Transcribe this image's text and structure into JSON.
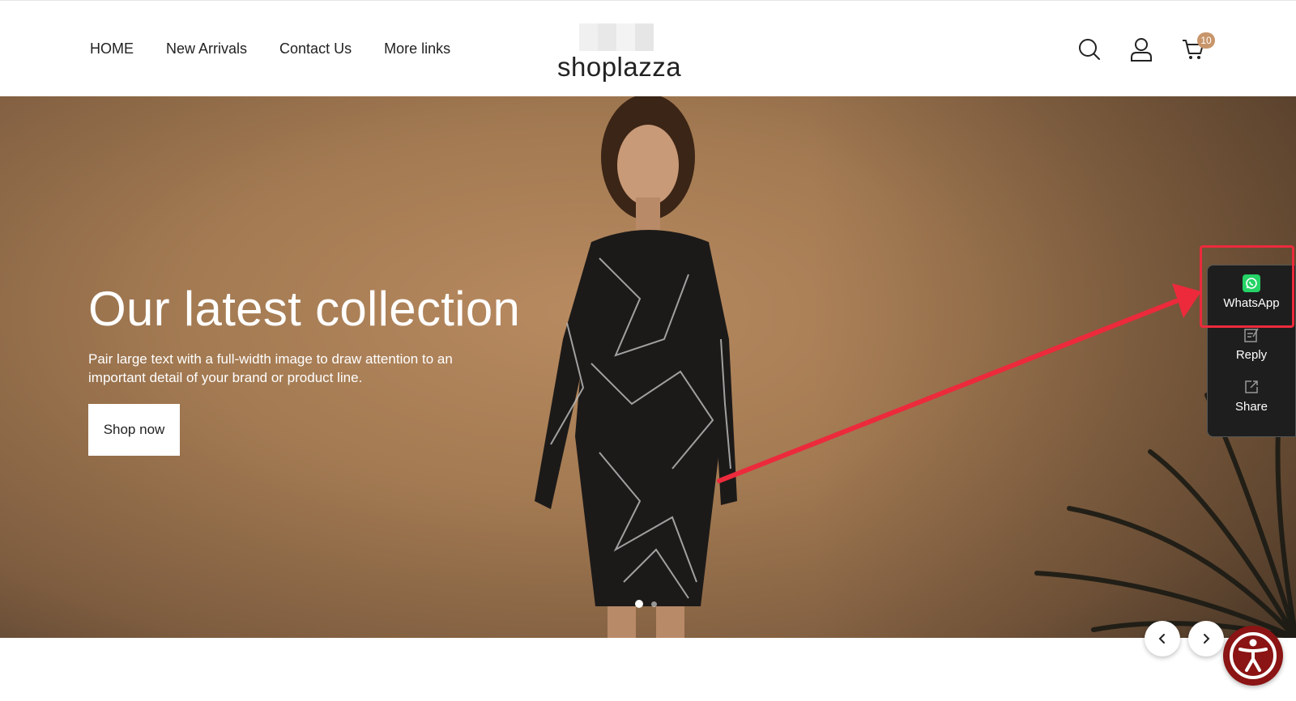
{
  "header": {
    "nav": [
      "HOME",
      "New Arrivals",
      "Contact Us",
      "More links"
    ],
    "logo_text": "shoplazza",
    "cart_count": "10",
    "icons": [
      "search-icon",
      "account-icon",
      "cart-icon"
    ]
  },
  "hero": {
    "title": "Our latest collection",
    "subtitle": "Pair large text with a full-width image to draw attention to an important detail of your brand or product line.",
    "button_label": "Shop now",
    "slides_total": 2,
    "active_slide": 1
  },
  "side_panel": {
    "items": [
      {
        "label": "WhatsApp",
        "icon": "whatsapp-icon"
      },
      {
        "label": "Reply",
        "icon": "reply-icon"
      },
      {
        "label": "Share",
        "icon": "share-icon"
      }
    ]
  },
  "colors": {
    "accent_badge": "#c8956a",
    "annotation_red": "#ec2a3c",
    "whatsapp_green": "#25d366",
    "accessibility": "#8b1414"
  }
}
